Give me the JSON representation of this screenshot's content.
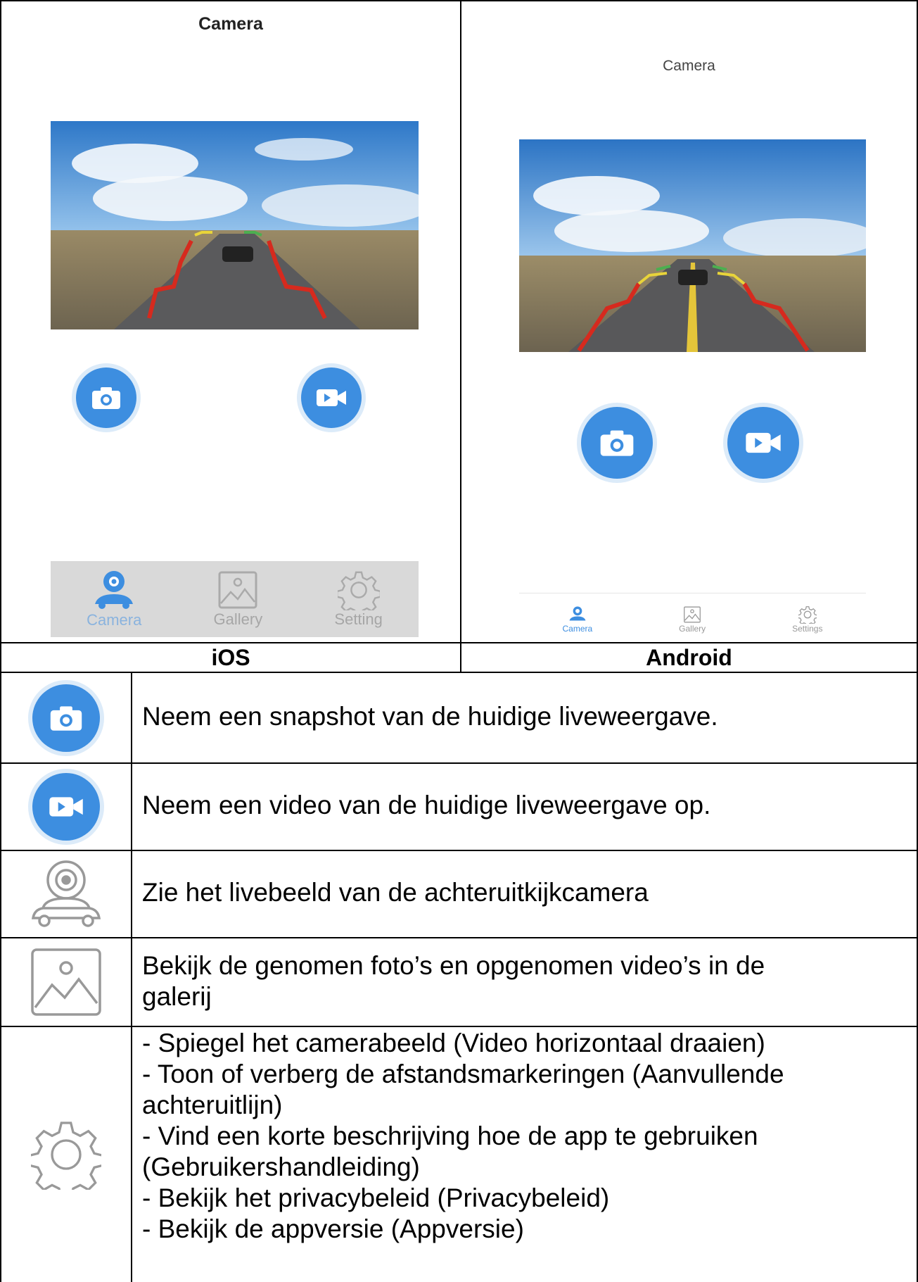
{
  "ios": {
    "title": "Camera",
    "tabs": [
      "Camera",
      "Gallery",
      "Setting"
    ],
    "label": "iOS"
  },
  "android": {
    "title": "Camera",
    "tabs": [
      "Camera",
      "Gallery",
      "Settings"
    ],
    "label": "Android"
  },
  "rows": [
    {
      "icon": "camera-snapshot-icon",
      "lines": [
        "Neem een snapshot van de huidige liveweergave."
      ]
    },
    {
      "icon": "video-record-icon",
      "lines": [
        "Neem een video van de huidige liveweergave op."
      ]
    },
    {
      "icon": "live-camera-car-icon",
      "lines": [
        "Zie het livebeeld van de achteruitkijkcamera"
      ]
    },
    {
      "icon": "gallery-image-icon",
      "lines": [
        "Bekijk de genomen foto’s en opgenomen video’s in de",
        "galerij"
      ]
    },
    {
      "icon": "settings-gear-icon",
      "lines": [
        "- Spiegel het camerabeeld (Video horizontaal draaien)",
        "- Toon of verberg de afstandsmarkeringen (Aanvullende",
        "achteruitlijn)",
        "- Vind een korte beschrijving hoe de app te gebruiken",
        "(Gebruikershandleiding)",
        "- Bekijk het privacybeleid (Privacybeleid)",
        "- Bekijk de appversie (Appversie)"
      ]
    }
  ],
  "colors": {
    "accent": "#3d8ee0",
    "tabbar_ios": "#d9d9d9",
    "guide_red": "#d62a1e",
    "guide_yellow": "#e8d43a",
    "guide_green": "#4caf50"
  }
}
